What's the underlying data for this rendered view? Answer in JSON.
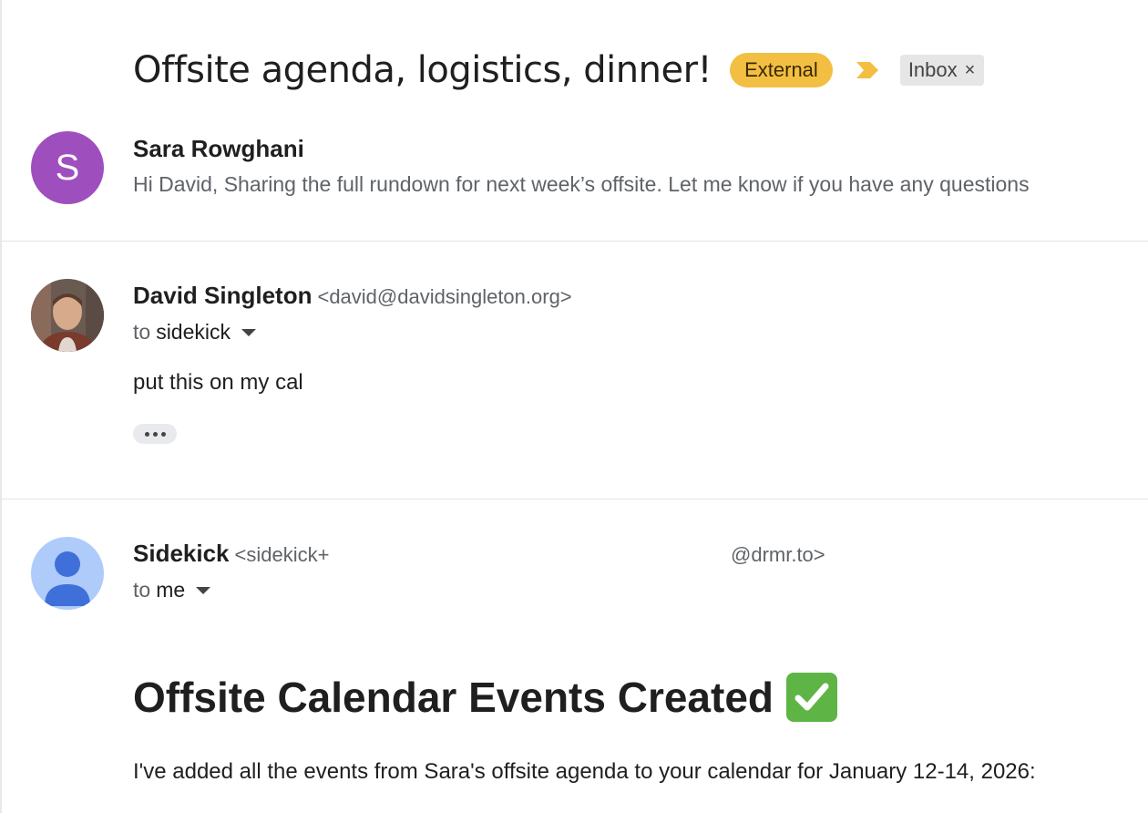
{
  "thread": {
    "subject": "Offsite agenda, logistics, dinner!",
    "labels": {
      "external": "External",
      "inbox": "Inbox",
      "inbox_remove": "×"
    },
    "colors": {
      "external_bg": "#f2bf42",
      "importance_marker": "#f2bf42",
      "inbox_bg": "#e6e6e6"
    }
  },
  "messages": [
    {
      "avatar_letter": "S",
      "avatar_color": "#9e4fbd",
      "sender_name": "Sara Rowghani",
      "snippet": "Hi David, Sharing the full rundown for next week’s offsite. Let me know if you have any questions"
    },
    {
      "avatar": "photo",
      "sender_name": "David Singleton",
      "sender_email": "<david@davidsingleton.org>",
      "to_prefix": "to",
      "to_recipient": "sidekick",
      "body": "put this on my cal",
      "trimmed_content_icon": "ellipsis-icon"
    },
    {
      "avatar": "generic-person-icon",
      "avatar_color": "#aecbfa",
      "sender_name": "Sidekick",
      "sender_email_start": "<sidekick+",
      "sender_email_end": "@drmr.to>",
      "to_prefix": "to",
      "to_recipient": "me",
      "heading": "Offsite Calendar Events Created",
      "heading_icon": "check-mark-button-icon",
      "body": "I've added all the events from Sara's offsite agenda to your calendar for January 12-14, 2026:"
    }
  ]
}
